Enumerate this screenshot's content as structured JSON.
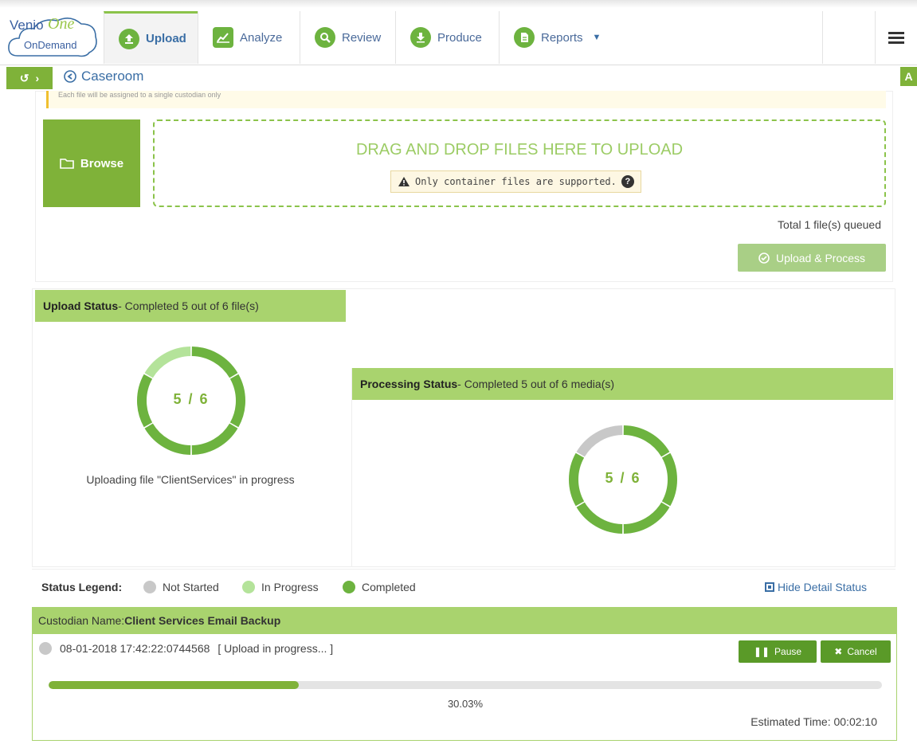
{
  "brand": {
    "name_part1": "Venio",
    "name_part2": "One",
    "name_part3": "OnDemand"
  },
  "nav": {
    "tabs": [
      {
        "label": "Upload",
        "icon": "upload-icon",
        "active": true
      },
      {
        "label": "Analyze",
        "icon": "chart-icon",
        "active": false
      },
      {
        "label": "Review",
        "icon": "search-icon",
        "active": false
      },
      {
        "label": "Produce",
        "icon": "download-icon",
        "active": false
      },
      {
        "label": "Reports",
        "icon": "document-icon",
        "active": false
      }
    ],
    "menu_icon": "hamburger-icon"
  },
  "breadcrumb": {
    "back_label": "Caseroom",
    "right_badge": "A"
  },
  "upload": {
    "warning_text": "Each file will be assigned to a single custodian only",
    "browse_label": "Browse",
    "drop_title": "DRAG AND DROP FILES HERE TO UPLOAD",
    "drop_note": "Only container files are supported.",
    "queued_text": "Total 1 file(s) queued",
    "process_button": "Upload & Process"
  },
  "upload_status": {
    "title": "Upload Status",
    "subtitle": " - Completed 5 out of 6 file(s)",
    "ring_label": "5 / 6",
    "completed": 5,
    "in_progress": 1,
    "not_started": 0,
    "total": 6,
    "message": "Uploading file \"ClientServices\" in progress"
  },
  "processing_status": {
    "title": "Processing Status",
    "subtitle": " - Completed 5 out of 6 media(s)",
    "ring_label": "5 / 6",
    "completed": 5,
    "in_progress": 0,
    "not_started": 1,
    "total": 6
  },
  "legend": {
    "label": "Status Legend:",
    "items": [
      {
        "label": "Not Started",
        "color": "#c8c8c8"
      },
      {
        "label": "In Progress",
        "color": "#b4e39a"
      },
      {
        "label": "Completed",
        "color": "#6db33f"
      }
    ],
    "hide_detail": "Hide Detail Status"
  },
  "custodian": {
    "label": "Custodian Name: ",
    "name": "Client Services Email Backup",
    "job_id": "08-01-2018 17:42:22:0744568",
    "job_state": "[ Upload in progress... ]",
    "pause_label": "Pause",
    "cancel_label": "Cancel",
    "progress_fraction": 0.3003,
    "progress_text": "30.03%",
    "eta": "Estimated Time: 00:02:10"
  },
  "colors": {
    "completed": "#6db33f",
    "in_progress": "#b4e39a",
    "not_started": "#c8c8c8",
    "header_bar": "#a9d36e"
  }
}
